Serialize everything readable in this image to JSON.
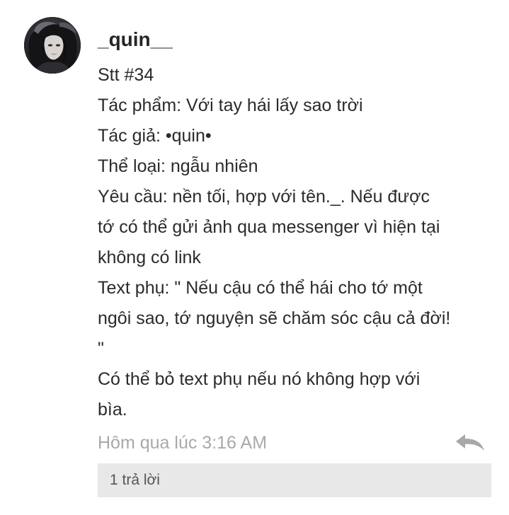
{
  "comment": {
    "username": "_quin__",
    "lines": [
      "Stt #34",
      "Tác phẩm: Với tay hái lấy sao trời",
      "Tác giả: •quin•",
      "Thể loại: ngẫu nhiên",
      "Yêu cầu: nền tối, hợp với tên._. Nếu được",
      "tớ có thể gửi ảnh qua messenger vì hiện tại",
      "không có link",
      "Text phụ: \" Nếu cậu có thể hái cho tớ một",
      "ngôi sao, tớ nguyện sẽ chăm sóc cậu cả đời!",
      "\"",
      "Có thể bỏ text phụ nếu nó không hợp với",
      "bìa."
    ],
    "timestamp": "Hôm qua lúc 3:16 AM",
    "reply_icon": "reply-arrow-icon",
    "replies_label": "1 trả lời"
  },
  "colors": {
    "username": "#262626",
    "body_text": "#2b2b2b",
    "timestamp": "#a9a9a9",
    "reply_icon": "#a8a8a8",
    "replies_bar": "#e8e8e8",
    "replies_text": "#555555"
  }
}
